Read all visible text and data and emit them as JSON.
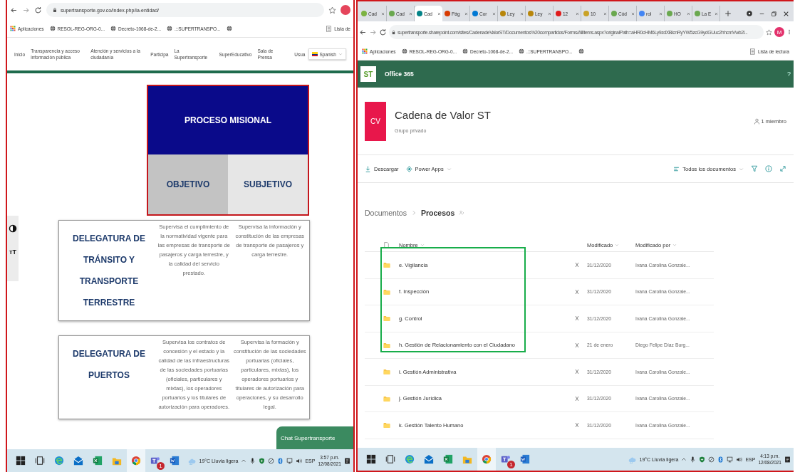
{
  "left_window": {
    "url": "supertransporte.gov.co/index.php/la-entidad/",
    "bookmarks": [
      "Aplicaciones",
      "RESOL-REG-ORG-0...",
      "Decreto-1068-de-2...",
      ".::SUPERTRANSPO..."
    ],
    "reading_list": "Lista de",
    "nav": [
      "Inicio",
      "Transparencia y acceso información pública",
      "Atención y servicios a la ciudadanía",
      "Participa",
      "La Supertransporte",
      "SuperEducativo",
      "Sala de Prensa",
      "Usua"
    ],
    "language": "Spanish",
    "process": {
      "title": "PROCESO MISIONAL",
      "outlined": true,
      "columns": [
        {
          "label": "OBJETIVO",
          "selected": true
        },
        {
          "label": "SUBJETIVO",
          "selected": false
        }
      ]
    },
    "text_size_icon": "тT",
    "delegaturas": [
      {
        "title": "DELEGATURA DE TRÁNSITO Y TRANSPORTE TERRESTRE",
        "objetivo": "Supervisa el cumplimiento de la normatividad vigente para las empresas de transporte de pasajeros y carga terrestre, y la calidad del servicio prestado.",
        "subjetivo": "Supervisa la información y constitución de las empresas de transporte de pasajeros y carga terrestre."
      },
      {
        "title": "DELEGATURA DE PUERTOS",
        "objetivo": "Supervisa los contratos de concesión y el estado y la calidad de las infraestructuras de las sociedades portuarias (oficiales, particulares y mixtas), los operadores portuarios y los titulares de autorización para operadores.",
        "subjetivo": "Supervisa la formación y constitución de las sociedades portuarias (oficiales, particulares, mixtas), los operadores portuarios y titulares de autorización para operaciones, y su desarrollo legal."
      }
    ],
    "chat_button": "Chat Supertransporte",
    "taskbar": {
      "apps": [
        {
          "kind": "start",
          "selected": false
        },
        {
          "kind": "taskview",
          "selected": false
        },
        {
          "kind": "edge",
          "selected": false
        },
        {
          "kind": "mail",
          "selected": false
        },
        {
          "kind": "excel",
          "selected": false
        },
        {
          "kind": "files",
          "selected": false
        },
        {
          "kind": "chrome",
          "selected": true
        },
        {
          "kind": "teams",
          "selected": false,
          "badge": "1"
        },
        {
          "kind": "word",
          "selected": false
        }
      ],
      "weather": "19°C  Lluvia ligera",
      "language": "ESP",
      "time": "3:57 p.m.",
      "date": "12/08/2021"
    }
  },
  "right_window": {
    "tabs": [
      {
        "label": "Cad",
        "selected": false,
        "color": "#7cb342"
      },
      {
        "label": "Cad",
        "selected": false,
        "color": "#6aa84f"
      },
      {
        "label": "Cad",
        "selected": true,
        "color": "#038387"
      },
      {
        "label": "Pág",
        "selected": false,
        "color": "#d83b01"
      },
      {
        "label": "Cor",
        "selected": false,
        "color": "#0078d4"
      },
      {
        "label": "Ley",
        "selected": false,
        "color": "#b8860b"
      },
      {
        "label": "Ley",
        "selected": false,
        "color": "#b8860b"
      },
      {
        "label": "12",
        "selected": false,
        "color": "#e01b1b"
      },
      {
        "label": "10",
        "selected": false,
        "color": "#c9a227"
      },
      {
        "label": "Cód",
        "selected": false,
        "color": "#6aa84f"
      },
      {
        "label": "rol",
        "selected": false,
        "color": "#4285f4"
      },
      {
        "label": "HO",
        "selected": false,
        "color": "#6aa84f"
      },
      {
        "label": "La E",
        "selected": false,
        "color": "#6aa84f"
      }
    ],
    "url": "supertransporte.sharepoint.com/sites/CadenadeValorST/Documentos%20compartidos/Forms/AllItems.aspx?originalPath=aHR0cHM6Ly9zdXBlcnRyYW5zcG9ydGUuc2hhcmVwb2l...",
    "profile": "M",
    "bookmarks": [
      "Aplicaciones",
      "RESOL-REG-ORG-0...",
      "Decreto-1068-de-2...",
      ".::SUPERTRANSPO..."
    ],
    "reading_list": "Lista de lectura",
    "suite": {
      "logo": "ST",
      "title": "Office 365",
      "help": "?"
    },
    "site": {
      "tile": "CV",
      "title": "Cadena de Valor ST",
      "subtitle": "Grupo privado",
      "members": "1 miembro"
    },
    "commands": {
      "download": "Descargar",
      "power_apps": "Power Apps",
      "view": "Todos los documentos"
    },
    "breadcrumb": {
      "parent": "Documentos",
      "current": "Procesos"
    },
    "columns": {
      "name": "Nombre",
      "modified": "Modificado",
      "modified_by": "Modificado por"
    },
    "rows": [
      {
        "name": "e. Vigilancia",
        "modified": "31/12/2020",
        "modified_by": "Ivana Carolina Gonzale...",
        "outlined": true
      },
      {
        "name": "f. Inspección",
        "modified": "31/12/2020",
        "modified_by": "Ivana Carolina Gonzale...",
        "outlined": true
      },
      {
        "name": "g. Control",
        "modified": "31/12/2020",
        "modified_by": "Ivana Carolina Gonzale...",
        "outlined": true
      },
      {
        "name": "h. Gestión de Relacionamiento con el Ciudadano",
        "modified": "21 de enero",
        "modified_by": "Diego Felipe Díaz Burg...",
        "outlined": true
      },
      {
        "name": "i. Gestión Administrativa",
        "modified": "31/12/2020",
        "modified_by": "Ivana Carolina Gonzale...",
        "outlined": false
      },
      {
        "name": "j. Gestión Jurídica",
        "modified": "31/12/2020",
        "modified_by": "Ivana Carolina Gonzale...",
        "outlined": false
      },
      {
        "name": "k. Gestión Talento Humano",
        "modified": "31/12/2020",
        "modified_by": "Ivana Carolina Gonzale...",
        "outlined": false
      }
    ],
    "taskbar": {
      "apps": [
        {
          "kind": "start",
          "selected": false
        },
        {
          "kind": "taskview",
          "selected": false
        },
        {
          "kind": "edge",
          "selected": false
        },
        {
          "kind": "mail",
          "selected": false
        },
        {
          "kind": "excel",
          "selected": false
        },
        {
          "kind": "files",
          "selected": false
        },
        {
          "kind": "chrome",
          "selected": true
        },
        {
          "kind": "teams",
          "selected": false,
          "badge": "1"
        },
        {
          "kind": "word",
          "selected": false
        }
      ],
      "weather": "19°C  Lluvia ligera",
      "language": "ESP",
      "time": "4:13 p.m.",
      "date": "12/08/2021"
    }
  }
}
